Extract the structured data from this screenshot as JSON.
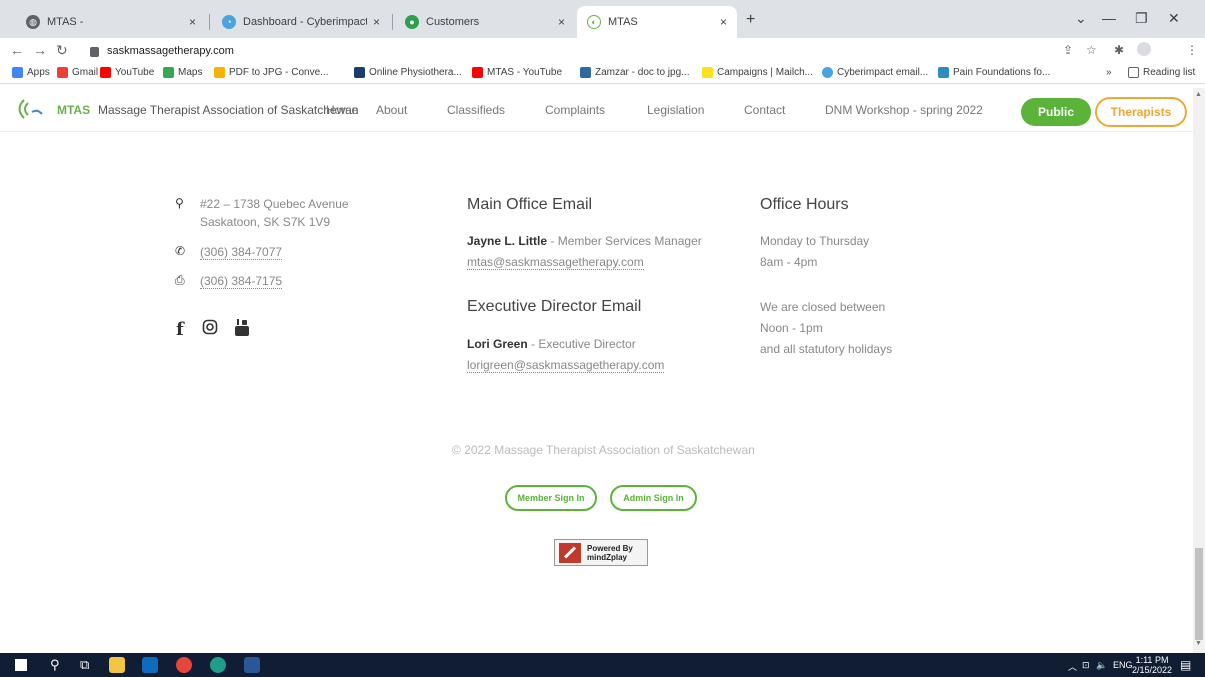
{
  "browser": {
    "tabs": [
      {
        "label": "MTAS -",
        "active": false
      },
      {
        "label": "Dashboard - Cyberimpact",
        "active": false
      },
      {
        "label": "Customers",
        "active": false
      },
      {
        "label": "MTAS",
        "active": true
      }
    ],
    "tab_close": "×",
    "new_tab": "+",
    "url": "saskmassagetherapy.com",
    "bookmarks": [
      {
        "label": "Apps",
        "color": "#4285f4"
      },
      {
        "label": "Gmail",
        "color": "#ea4335"
      },
      {
        "label": "YouTube",
        "color": "#ff0000"
      },
      {
        "label": "Maps",
        "color": "#34a853"
      },
      {
        "label": "PDF to JPG - Conve...",
        "color": "#f4b400"
      },
      {
        "label": "Online Physiothera...",
        "color": "#1a3d6e"
      },
      {
        "label": "MTAS - YouTube",
        "color": "#ff0000"
      },
      {
        "label": "Zamzar - doc to jpg...",
        "color": "#2c6aa0"
      },
      {
        "label": "Campaigns | Mailch...",
        "color": "#ffe01b"
      },
      {
        "label": "Cyberimpact email...",
        "color": "#4aa3df"
      },
      {
        "label": "Pain Foundations fo...",
        "color": "#2a8fbd"
      }
    ],
    "bookmarks_overflow": "»",
    "reading_list": "Reading list"
  },
  "site": {
    "brand_short": "MTAS",
    "brand_full": "Massage Therapist Association of Saskatchewan",
    "nav": [
      "Home",
      "About",
      "Classifieds",
      "Complaints",
      "Legislation",
      "Contact",
      "DNM Workshop - spring 2022"
    ],
    "btn_public": "Public",
    "btn_therapists": "Therapists",
    "accent": "#5cb33a",
    "accent_orange": "#f0a733"
  },
  "contact": {
    "address_line1": "#22 – 1738 Quebec Avenue",
    "address_line2": "Saskatoon, SK S7K 1V9",
    "phone": "(306) 384-7077",
    "fax": "(306) 384-7175"
  },
  "main_office": {
    "heading": "Main Office Email",
    "name": "Jayne L. Little",
    "role": " - Member Services Manager",
    "email": "mtas@saskmassagetherapy.com"
  },
  "exec_director": {
    "heading": "Executive Director Email",
    "name": "Lori Green",
    "role": " - Executive Director",
    "email": "lorigreen@saskmassagetherapy.com"
  },
  "office_hours": {
    "heading": "Office Hours",
    "days": "Monday to Thursday",
    "hours": "8am - 4pm",
    "closed_line1": "We are closed between",
    "closed_line2": "Noon - 1pm",
    "closed_line3": "and all statutory holidays"
  },
  "footer": {
    "copyright": "© 2022 Massage Therapist Association of Saskatchewan",
    "member_sign_in": "Member Sign In",
    "admin_sign_in": "Admin Sign In",
    "powered_by_line1": "Powered By",
    "powered_by_line2": "mindZplay"
  },
  "taskbar": {
    "language": "ENG",
    "time": "1:11 PM",
    "date": "2/15/2022"
  }
}
